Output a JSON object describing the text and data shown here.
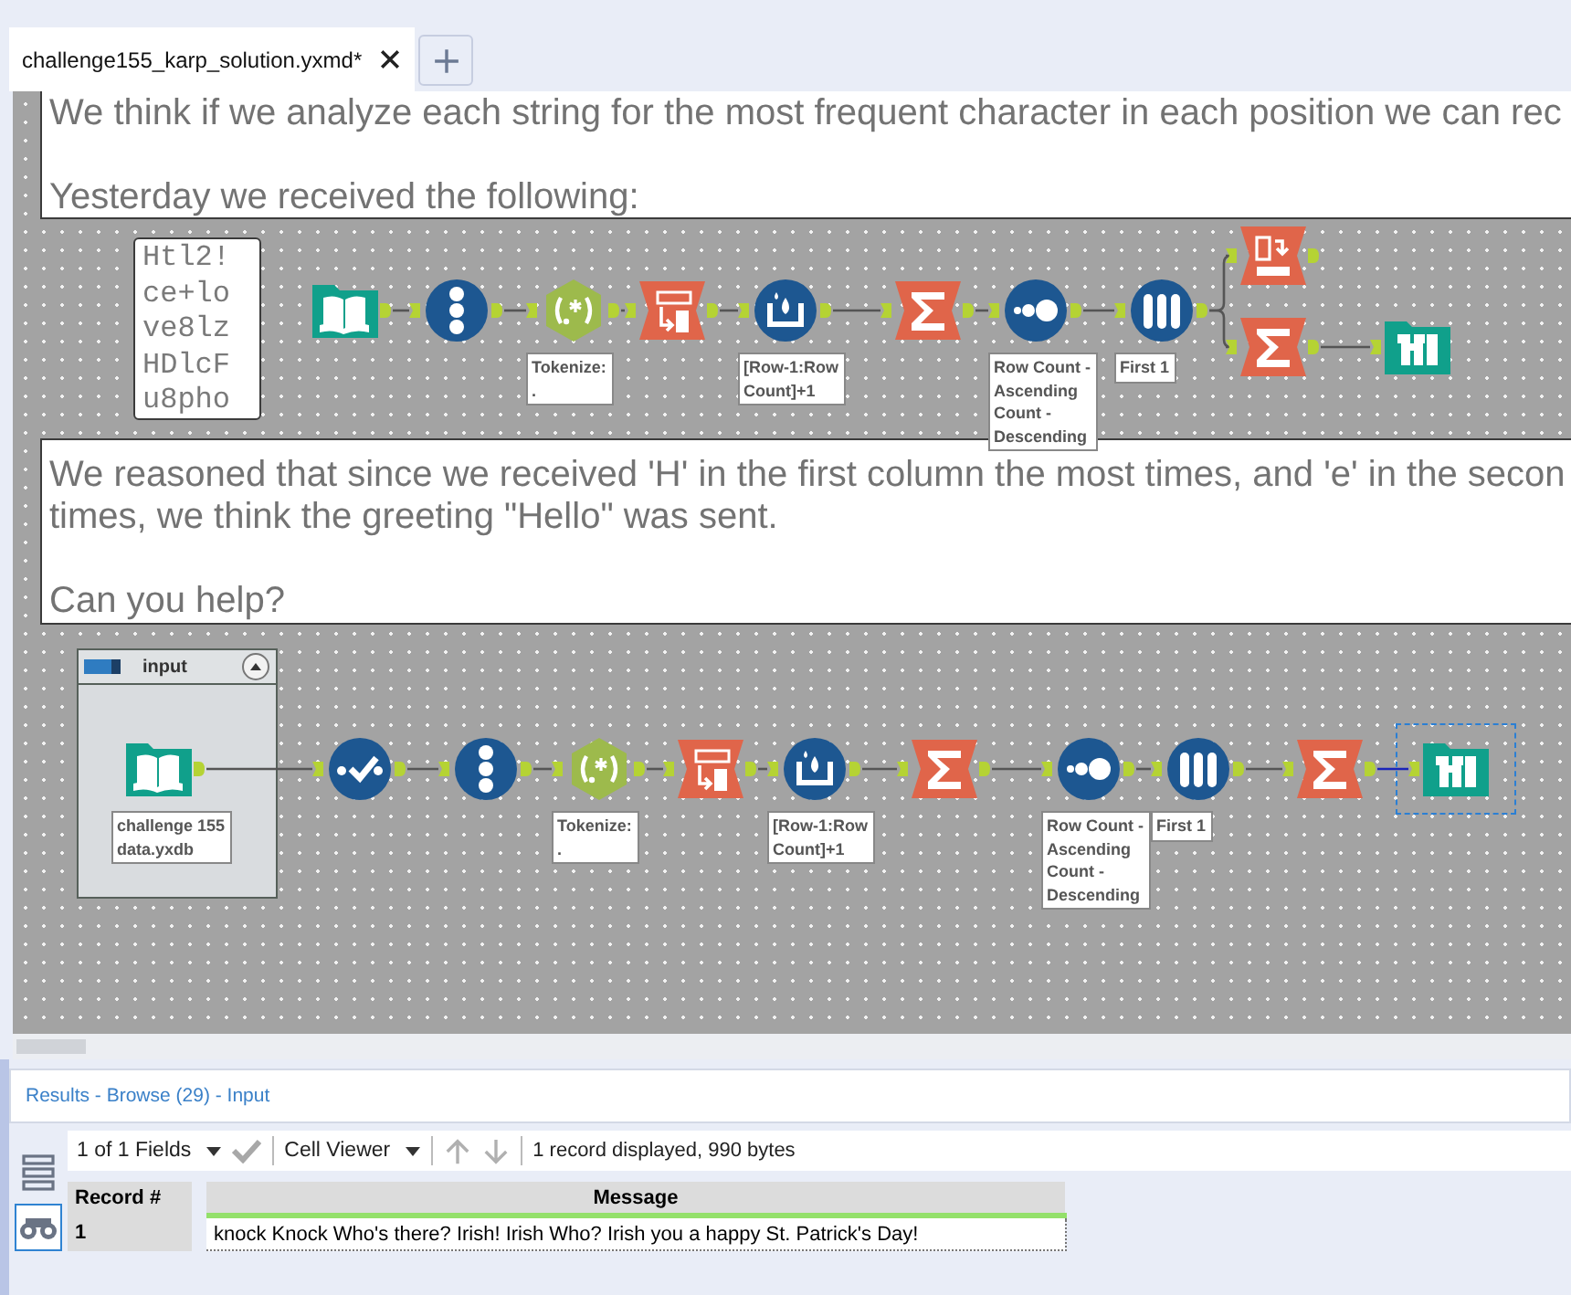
{
  "tabs": [
    {
      "label": "challenge155_karp_solution.yxmd*",
      "selected": true
    }
  ],
  "canvas": {
    "comments": [
      {
        "kind": "comment",
        "paragraphs": [
          "We think if we analyze each string for the most frequent character in each position we can rec",
          "Yesterday we received the following:"
        ]
      },
      {
        "kind": "sample",
        "paragraphs": [
          "Htl2!\nce+lo\nve8lz\nHDlcF\nu8pho"
        ]
      },
      {
        "kind": "comment",
        "paragraphs": [
          "We reasoned that since we received 'H' in the first column the most times, and 'e' in the secon\ntimes, we think the greeting \"Hello\" was sent.",
          "Can you help?"
        ]
      }
    ],
    "container": {
      "title": "input",
      "expanded": true
    },
    "rows": [
      {
        "tools": [
          {
            "kind": "input",
            "selected": false
          },
          {
            "kind": "record-id",
            "selected": false
          },
          {
            "kind": "regex",
            "annotation": "Tokenize:\n.",
            "selected": false
          },
          {
            "kind": "crosstab",
            "selected": false
          },
          {
            "kind": "multi-row",
            "annotation": "[Row-1:Row\nCount]+1",
            "selected": false
          },
          {
            "kind": "summarize",
            "selected": false
          },
          {
            "kind": "sort",
            "annotation": "Row Count -\nAscending\nCount -\nDescending",
            "selected": false
          },
          {
            "kind": "sample",
            "annotation": "First 1",
            "selected": false
          },
          {
            "kind": "transpose",
            "selected": false
          },
          {
            "kind": "summarize",
            "selected": false
          },
          {
            "kind": "browse",
            "selected": false
          }
        ]
      },
      {
        "tools": [
          {
            "kind": "input",
            "annotation": "challenge 155\ndata.yxdb",
            "selected": false
          },
          {
            "kind": "select",
            "selected": false
          },
          {
            "kind": "record-id",
            "selected": false
          },
          {
            "kind": "regex",
            "annotation": "Tokenize:\n.",
            "selected": false
          },
          {
            "kind": "crosstab",
            "selected": false
          },
          {
            "kind": "multi-row",
            "annotation": "[Row-1:Row\nCount]+1",
            "selected": false
          },
          {
            "kind": "summarize",
            "selected": false
          },
          {
            "kind": "sort",
            "annotation": "Row Count -\nAscending\nCount -\nDescending",
            "selected": false
          },
          {
            "kind": "sample",
            "annotation": "First 1",
            "selected": false
          },
          {
            "kind": "summarize",
            "selected": false
          },
          {
            "kind": "browse",
            "selected": true
          }
        ]
      }
    ]
  },
  "results": {
    "title": "Results - Browse (29) - Input",
    "fields_selector": "1 of 1 Fields",
    "viewer_selector": "Cell Viewer",
    "status": "1 record displayed, 990 bytes",
    "views": [
      {
        "kind": "list",
        "selected": false
      },
      {
        "kind": "binoculars",
        "selected": true
      }
    ],
    "table": {
      "columns": [
        "Record #",
        "Message"
      ],
      "rows": [
        [
          "1",
          "knock Knock Who's there? Irish! Irish Who? Irish you a happy St. Patrick's Day!"
        ]
      ]
    }
  }
}
